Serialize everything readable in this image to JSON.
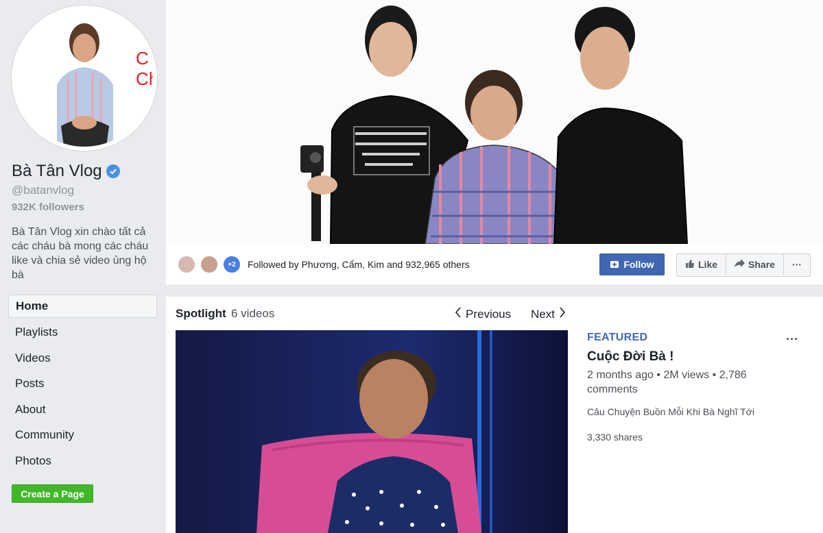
{
  "page": {
    "avatar_text": "C\nCh",
    "name": "Bà Tân Vlog",
    "handle": "@batanvlog",
    "followers": "932K followers",
    "bio": "Bà Tân Vlog xin chào tất cả các cháu bà mong các cháu like và chia sẻ video ủng hộ bà"
  },
  "nav": {
    "items": [
      "Home",
      "Playlists",
      "Videos",
      "Posts",
      "About",
      "Community",
      "Photos"
    ],
    "active": "Home",
    "create_page": "Create a Page"
  },
  "actions": {
    "more_friends_badge": "+2",
    "followed_by": "Followed by Phương, Cẩm, Kim and 932,965 others",
    "follow": "Follow",
    "like": "Like",
    "share": "Share",
    "more": "···"
  },
  "spotlight": {
    "title": "Spotlight",
    "count": "6 videos",
    "previous": "Previous",
    "next": "Next"
  },
  "featured_video": {
    "badge": "FEATURED",
    "title": "Cuộc Đời Bà !",
    "meta": "2 months ago • 2M views • 2,786 comments",
    "description": "Câu Chuyện Buồn Mỗi Khi Bà Nghĩ Tới",
    "shares": "3,330 shares",
    "menu": "···"
  },
  "colors": {
    "brand": "#4267b2",
    "create_green": "#42b72a",
    "verified": "#4a90e2"
  }
}
